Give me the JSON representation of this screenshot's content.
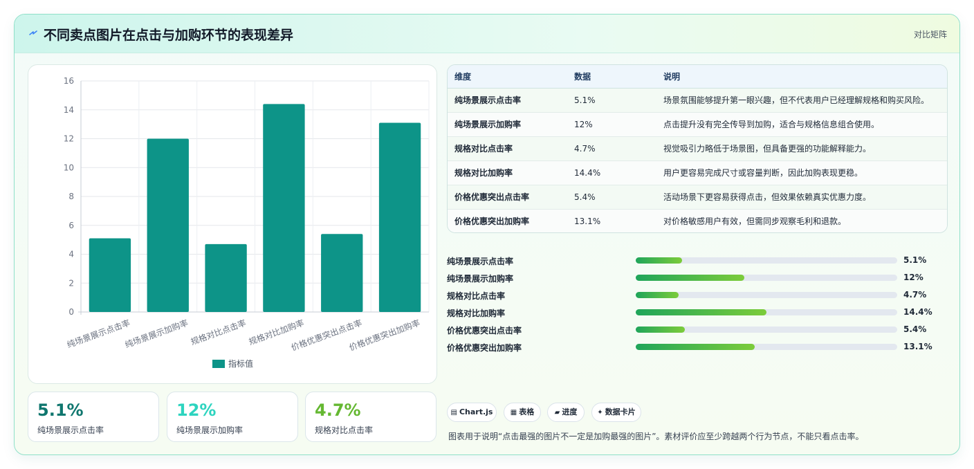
{
  "header": {
    "title": "不同卖点图片在点击与加购环节的表现差异",
    "tag": "对比矩阵",
    "bolt_icon": "lightning-icon"
  },
  "chart_data": {
    "type": "bar",
    "categories": [
      "纯场景展示点击率",
      "纯场景展示加购率",
      "规格对比点击率",
      "规格对比加购率",
      "价格优惠突出点击率",
      "价格优惠突出加购率"
    ],
    "series": [
      {
        "name": "指标值",
        "values": [
          5.1,
          12,
          4.7,
          14.4,
          5.4,
          13.1
        ]
      }
    ],
    "ylim": [
      0,
      16
    ],
    "yticks": [
      0,
      2,
      4,
      6,
      8,
      10,
      12,
      14,
      16
    ],
    "grid": true,
    "legend": "bottom",
    "color": "#0d9488"
  },
  "table": {
    "headers": [
      "维度",
      "数据",
      "说明"
    ],
    "rows": [
      {
        "dim": "纯场景展示点击率",
        "val": "5.1%",
        "desc": "场景氛围能够提升第一眼兴趣，但不代表用户已经理解规格和购买风险。"
      },
      {
        "dim": "纯场景展示加购率",
        "val": "12%",
        "desc": "点击提升没有完全传导到加购，适合与规格信息组合使用。"
      },
      {
        "dim": "规格对比点击率",
        "val": "4.7%",
        "desc": "视觉吸引力略低于场景图，但具备更强的功能解释能力。"
      },
      {
        "dim": "规格对比加购率",
        "val": "14.4%",
        "desc": "用户更容易完成尺寸或容量判断，因此加购表现更稳。"
      },
      {
        "dim": "价格优惠突出点击率",
        "val": "5.4%",
        "desc": "活动场景下更容易获得点击，但效果依赖真实优惠力度。"
      },
      {
        "dim": "价格优惠突出加购率",
        "val": "13.1%",
        "desc": "对价格敏感用户有效，但需同步观察毛利和退款。"
      }
    ]
  },
  "progress": [
    {
      "label": "纯场景展示点击率",
      "value": 5.1,
      "display": "5.1%"
    },
    {
      "label": "纯场景展示加购率",
      "value": 12,
      "display": "12%"
    },
    {
      "label": "规格对比点击率",
      "value": 4.7,
      "display": "4.7%"
    },
    {
      "label": "规格对比加购率",
      "value": 14.4,
      "display": "14.4%"
    },
    {
      "label": "价格优惠突出点击率",
      "value": 5.4,
      "display": "5.4%"
    },
    {
      "label": "价格优惠突出加购率",
      "value": 13.1,
      "display": "13.1%"
    }
  ],
  "progress_max": 150,
  "kpis": [
    {
      "value": "5.1%",
      "label": "纯场景展示点击率",
      "color": "#0f766e"
    },
    {
      "value": "12%",
      "label": "纯场景展示加购率",
      "color": "#2dd4bf"
    },
    {
      "value": "4.7%",
      "label": "规格对比点击率",
      "color": "#65b832"
    }
  ],
  "chips": [
    {
      "icon": "chart-icon",
      "label": "Chart.js"
    },
    {
      "icon": "table-icon",
      "label": "表格"
    },
    {
      "icon": "progress-icon",
      "label": "进度"
    },
    {
      "icon": "sparkle-icon",
      "label": "数据卡片"
    }
  ],
  "footnote": "图表用于说明“点击最强的图片不一定是加购最强的图片”。素材评价应至少跨越两个行为节点，不能只看点击率。"
}
